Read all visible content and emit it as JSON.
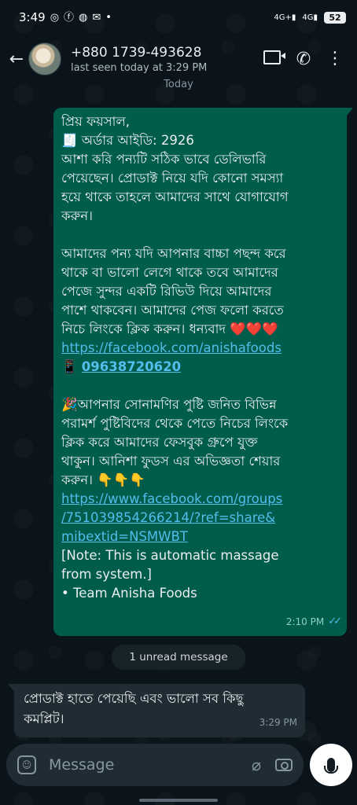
{
  "status_bar": {
    "time": "3:49",
    "left_icons": [
      "instagram-icon",
      "facebook-icon",
      "messenger-icon",
      "gmail-icon",
      "dot-icon"
    ],
    "network1": "4G+",
    "network2": "4G",
    "battery": "52"
  },
  "header": {
    "contact_name": "+880 1739-493628",
    "last_seen": "last seen today at 3:29 PM"
  },
  "date_chip": "Today",
  "outgoing_message": {
    "lines": [
      "প্রিয় ফয়সাল,",
      "🧾 অর্ডার আইডি: 2926",
      "আশা করি পন্যটি সঠিক ভাবে ডেলিভারি",
      "পেয়েছেন। প্রোডাক্ট নিয়ে যদি কোনো সমস্যা",
      "হয়ে থাকে তাহলে আমাদের সাথে যোগাযোগ",
      "করুন।",
      "",
      "আমাদের পন্য যদি আপনার বাচ্চা পছন্দ করে",
      "থাকে বা ভালো লেগে থাকে তবে আমাদের",
      "পেজে সুন্দর একটি রিভিউ দিয়ে আমাদের",
      "পাশে থাকবেন। আমাদের পেজ ফলো করতে"
    ],
    "line_with_hearts": "নিচে লিংকে ক্লিক করুন। ধন্যবাদ",
    "hearts": "❤️❤️❤️",
    "facebook_link": "https://facebook.com/anishafoods",
    "phone_emoji": "📱",
    "phone_number": "09638720620",
    "lines2": [
      "🎉আপনার সোনামণির পুষ্টি জনিত বিভিন্ন",
      "পরামর্শ পুষ্টিবিদের থেকে পেতে নিচের লিংকে",
      "ক্লিক করে আমাদের ফেসবুক গ্রুপে যুক্ত",
      "থাকুন। আনিশা ফুডস এর অভিজ্ঞতা শেয়ার"
    ],
    "line_with_pointers": "করুন।",
    "pointers": "👇👇👇",
    "group_link_lines": [
      "https://www.facebook.com/groups",
      "/751039854266214/?ref=share&",
      "mibextid=NSMWBT"
    ],
    "note_lines": [
      "[Note: This is automatic massage",
      "from system.]",
      "•  Team Anisha Foods"
    ],
    "time": "2:10 PM"
  },
  "unread_chip": "1 unread message",
  "incoming_message": {
    "lines": [
      "প্রোডাক্ট হাতে পেয়েছি এবং ভালো সব কিছু",
      "কমপ্লিট।"
    ],
    "time": "3:29 PM"
  },
  "input": {
    "placeholder": "Message"
  },
  "colors": {
    "chat_background": "#0b141a",
    "outgoing_bubble": "#005c4b",
    "incoming_bubble": "#202c33",
    "link": "#53bdeb",
    "read_ticks": "#53bdeb"
  }
}
